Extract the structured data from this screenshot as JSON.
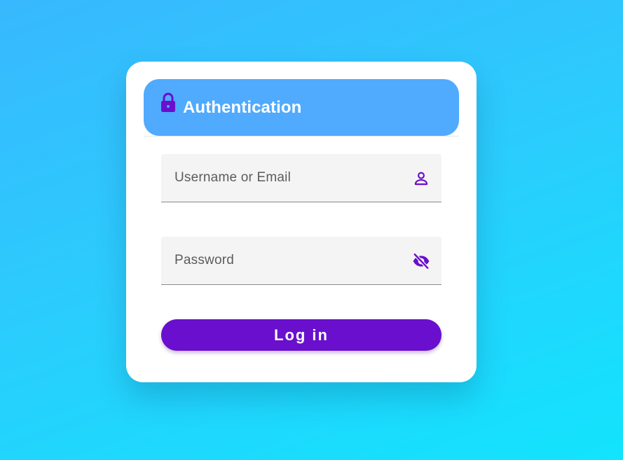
{
  "header": {
    "title": "Authentication",
    "icon": "lock-icon"
  },
  "form": {
    "username": {
      "value": "",
      "placeholder": "Username or Email",
      "icon": "user-icon"
    },
    "password": {
      "value": "",
      "placeholder": "Password",
      "icon": "eye-off-icon"
    },
    "submit_label": "Log in"
  },
  "colors": {
    "accent": "#6a0fcd",
    "header_background": "#50aafe",
    "card_background": "#ffffff",
    "field_background": "#f4f4f4",
    "page_gradient_start": "#38b8fe",
    "page_gradient_end": "#12e4fd"
  }
}
